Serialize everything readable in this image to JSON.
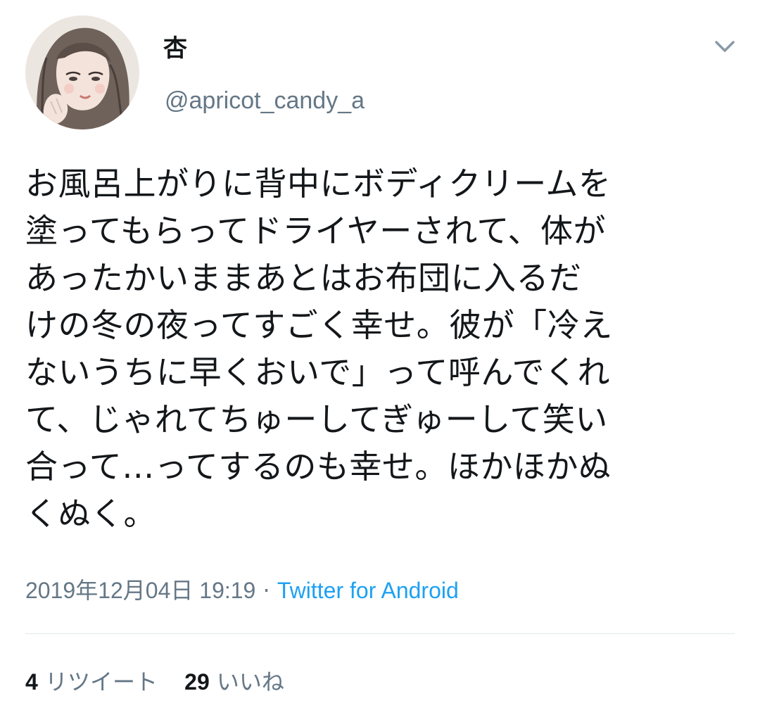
{
  "author": {
    "display_name": "杏",
    "handle": "@apricot_candy_a",
    "avatar_icon": "illustrated-portrait-avatar"
  },
  "menu": {
    "icon": "chevron-down-icon"
  },
  "tweet": {
    "lines": [
      "お風呂上がりに背中にボディクリームを",
      "塗ってもらってドライヤーされて、体が",
      "あったかいままあとはお布団に入るだ",
      "けの冬の夜ってすごく幸せ。彼が「冷え",
      "ないうちに早くおいで」って呼んでくれ",
      "て、じゃれてちゅーしてぎゅーして笑い",
      "合って…ってするのも幸せ。ほかほかぬ",
      "くぬく。"
    ],
    "timestamp": "2019年12月04日 19:19",
    "separator": "·",
    "source": "Twitter for Android"
  },
  "stats": {
    "retweets": {
      "count": "4",
      "label": "リツイート"
    },
    "likes": {
      "count": "29",
      "label": "いいね"
    }
  },
  "colors": {
    "text": "#14171a",
    "secondary": "#657786",
    "link": "#1da1f2",
    "divider": "#e1e8ed"
  }
}
